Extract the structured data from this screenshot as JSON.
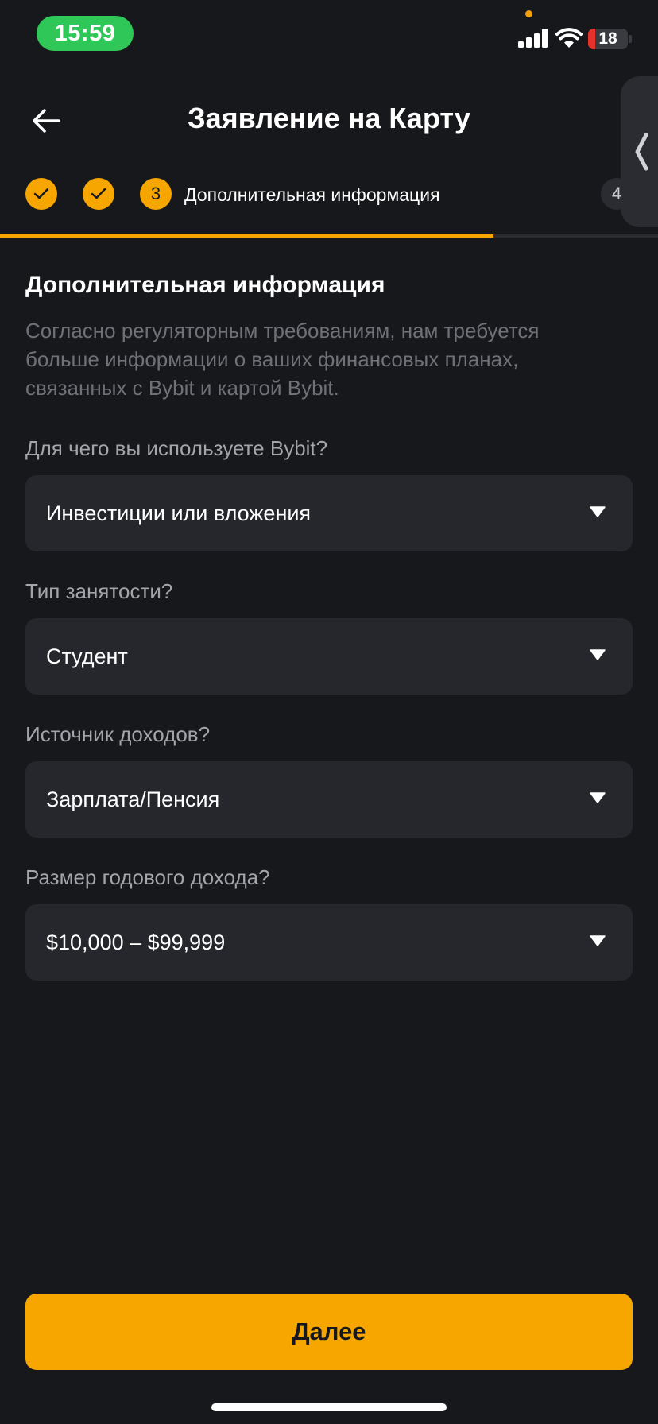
{
  "status_bar": {
    "time": "15:59",
    "battery": "18",
    "battery_level": 0.18,
    "colors": {
      "time_pill": "#30c759",
      "battery_low": "#e5322d",
      "dot": "#f59e0b"
    }
  },
  "header": {
    "title": "Заявление на Карту",
    "back_icon": "arrow-left-icon",
    "side_tab_icon": "chevron-left-icon"
  },
  "stepper": {
    "completed_icon": "check-icon",
    "current_step_number": "3",
    "current_step_label": "Дополнительная информация",
    "next_step_number": "4",
    "progress": 0.75
  },
  "main": {
    "title": "Дополнительная информация",
    "description": "Согласно регуляторным требованиям, нам требуется больше информации о ваших финансовых планах, связанных с Bybit и картой Bybit.",
    "fields": [
      {
        "question": "Для чего вы используете Bybit?",
        "value": "Инвестиции или вложения"
      },
      {
        "question": "Тип занятости?",
        "value": "Студент"
      },
      {
        "question": "Источник доходов?",
        "value": "Зарплата/Пенсия"
      },
      {
        "question": "Размер годового дохода?",
        "value": "$10,000 – $99,999"
      }
    ]
  },
  "footer": {
    "next_label": "Далее"
  },
  "colors": {
    "background": "#17181c",
    "accent": "#f7a600",
    "field_bg": "#25272c"
  }
}
